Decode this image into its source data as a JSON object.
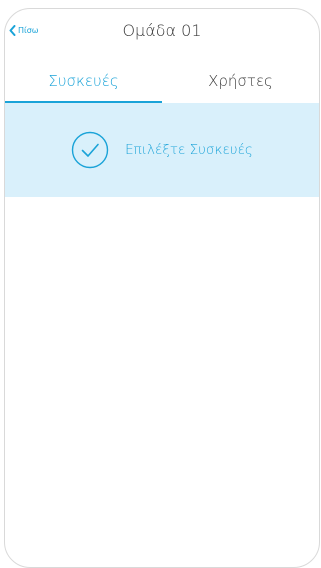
{
  "header": {
    "back_label": "Πίσω",
    "title": "Ομάδα 01"
  },
  "tabs": [
    {
      "label": "Συσκευές",
      "active": true
    },
    {
      "label": "Χρήστες",
      "active": false
    }
  ],
  "banner": {
    "text": "Επιλέξτε Συσκευές",
    "icon": "check-circle-icon"
  },
  "colors": {
    "accent": "#1aa3d8",
    "banner_bg": "#d9f0fb",
    "text": "#3b3b3b"
  }
}
